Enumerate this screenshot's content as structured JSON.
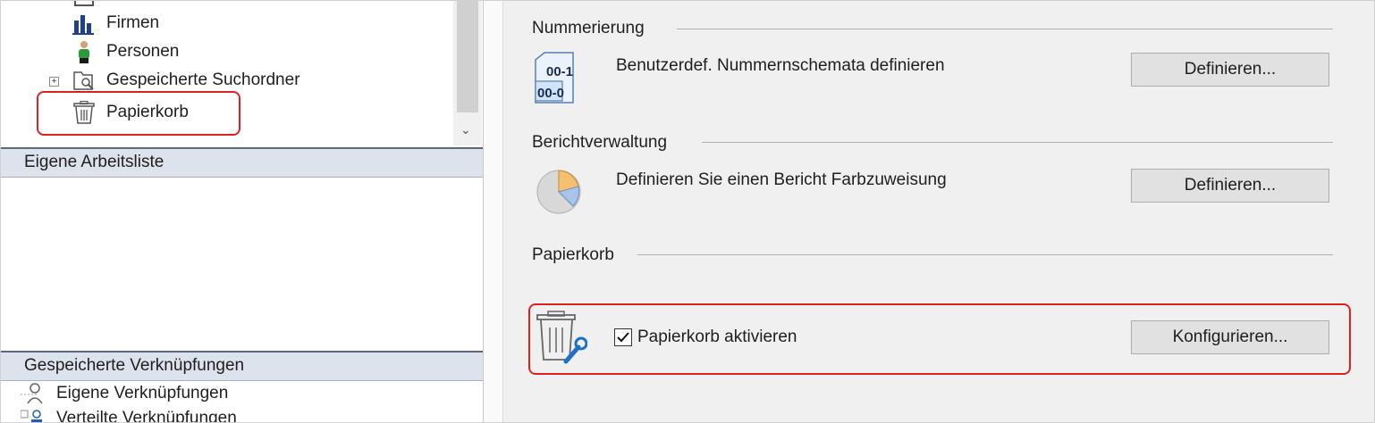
{
  "tree": {
    "items": [
      {
        "label": "Firmen",
        "icon": "bar-chart-icon"
      },
      {
        "label": "Personen",
        "icon": "person-icon"
      },
      {
        "label": "Gespeicherte Suchordner",
        "icon": "search-folder-icon"
      },
      {
        "label": "Papierkorb",
        "icon": "trash-icon"
      }
    ]
  },
  "sections": {
    "worklist": "Eigene Arbeitsliste",
    "saved_links": "Gespeicherte Verknüpfungen"
  },
  "links": [
    {
      "label": "Eigene Verknüpfungen",
      "icon": "user-icon"
    },
    {
      "label": "Verteilte Verknüpfungen",
      "icon": "shared-user-icon"
    }
  ],
  "settings": {
    "numbering": {
      "title": "Nummerierung",
      "description": "Benutzerdef. Nummernschemata definieren",
      "button": "Definieren...",
      "icon_text_top": "00-1",
      "icon_text_bottom": "00-0"
    },
    "reports": {
      "title": "Berichtverwaltung",
      "description": "Definieren Sie einen Bericht Farbzuweisung",
      "button": "Definieren..."
    },
    "trash": {
      "title": "Papierkorb",
      "checkbox_label": "Papierkorb aktivieren",
      "checked": true,
      "button": "Konfigurieren..."
    }
  },
  "colors": {
    "highlight": "#e02020",
    "section_header": "#dde3ec",
    "panel_bg": "#f0f0f0"
  }
}
